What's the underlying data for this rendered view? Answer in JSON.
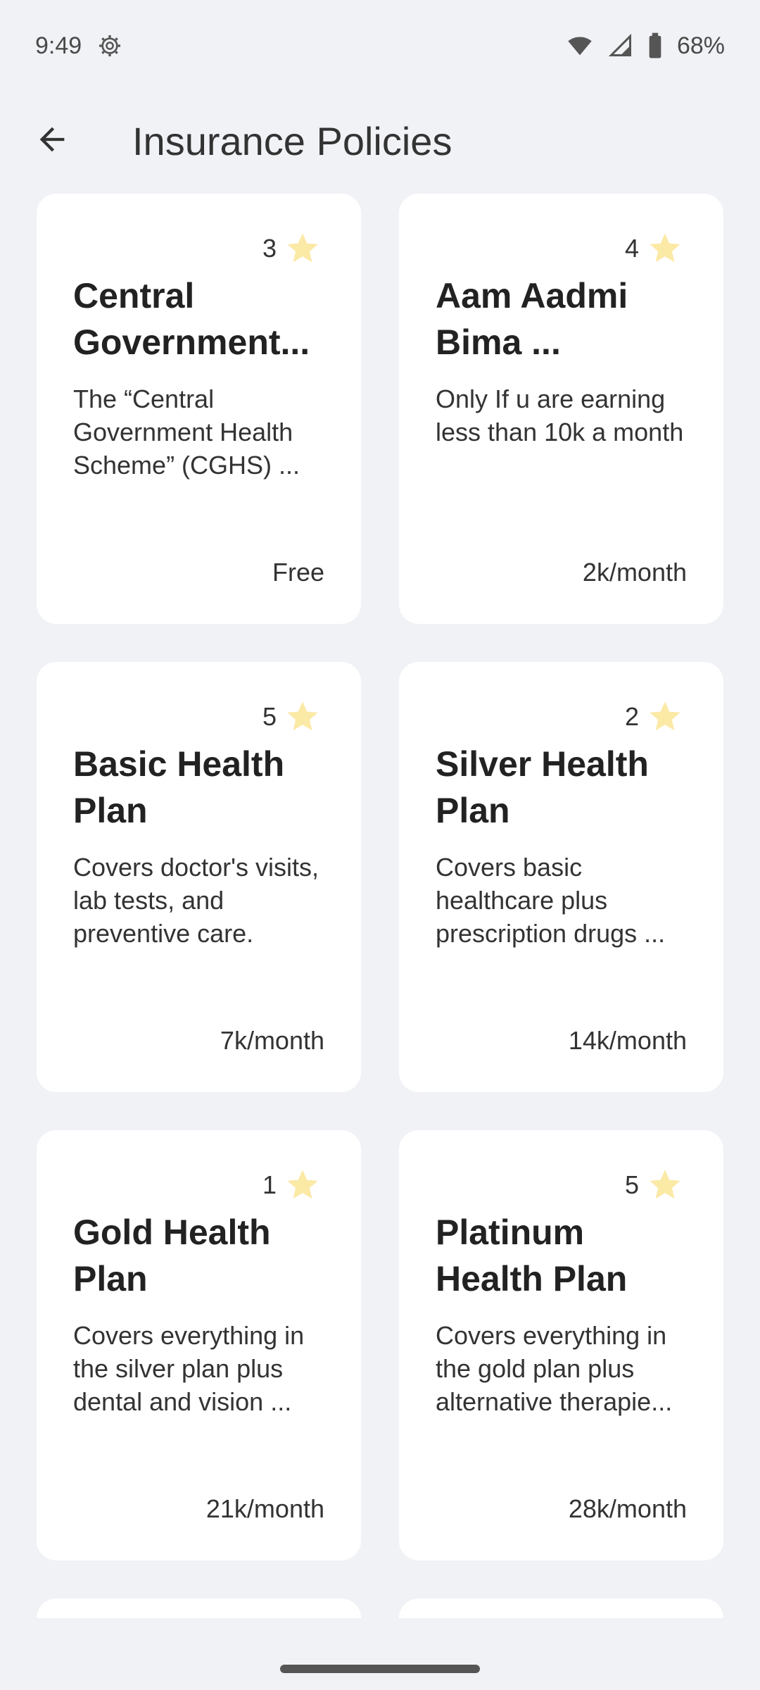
{
  "status": {
    "time": "9:49",
    "battery": "68%",
    "icons": [
      "settings-gear-icon",
      "wifi-icon",
      "signal-icon",
      "battery-icon"
    ]
  },
  "header": {
    "title": "Insurance Policies",
    "back_icon": "arrow-back-icon"
  },
  "policies": [
    {
      "rating": "3",
      "title": "Central Government...",
      "description": "The “Central Government Health Scheme” (CGHS) ...",
      "price": "Free"
    },
    {
      "rating": "4",
      "title": "Aam Aadmi Bima ...",
      "description": "Only If u are earning less than 10k a month",
      "price": "2k/month"
    },
    {
      "rating": "5",
      "title": "Basic Health Plan",
      "description": "Covers doctor's visits, lab tests, and preventive care.",
      "price": "7k/month"
    },
    {
      "rating": "2",
      "title": "Silver Health Plan",
      "description": "Covers basic healthcare plus prescription drugs ...",
      "price": "14k/month"
    },
    {
      "rating": "1",
      "title": "Gold Health Plan",
      "description": "Covers everything in the silver plan plus dental and vision ...",
      "price": "21k/month"
    },
    {
      "rating": "5",
      "title": "Platinum Health Plan",
      "description": "Covers everything in the gold plan plus alternative therapie...",
      "price": "28k/month"
    }
  ],
  "colors": {
    "background": "#f1f2f6",
    "card": "#ffffff",
    "star": "#fbe9a6"
  }
}
